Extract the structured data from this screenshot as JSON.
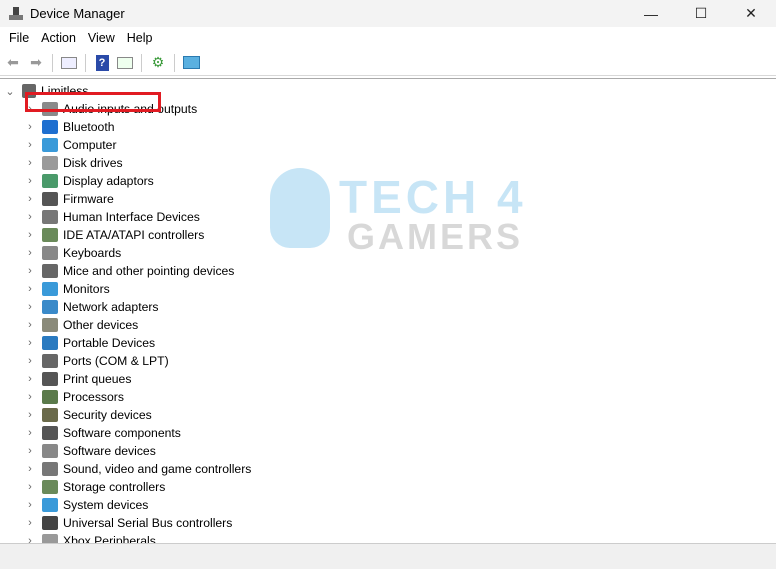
{
  "window": {
    "title": "Device Manager",
    "minimize": "—",
    "maximize": "☐",
    "close": "✕"
  },
  "menu": [
    "File",
    "Action",
    "View",
    "Help"
  ],
  "toolbar": {
    "icons": [
      "back-arrow-icon",
      "forward-arrow-icon",
      "properties-icon",
      "help-icon",
      "update-driver-icon",
      "scan-hardware-icon",
      "monitor-icon"
    ]
  },
  "tree": {
    "root": "Limitless",
    "items": [
      {
        "label": "Audio inputs and outputs",
        "color": "#8a8a8a"
      },
      {
        "label": "Bluetooth",
        "color": "#1e6fd0"
      },
      {
        "label": "Computer",
        "color": "#3a9ad9"
      },
      {
        "label": "Disk drives",
        "color": "#9a9a9a"
      },
      {
        "label": "Display adaptors",
        "color": "#4a9a6a"
      },
      {
        "label": "Firmware",
        "color": "#555555"
      },
      {
        "label": "Human Interface Devices",
        "color": "#777777"
      },
      {
        "label": "IDE ATA/ATAPI controllers",
        "color": "#6a8a5a"
      },
      {
        "label": "Keyboards",
        "color": "#888888"
      },
      {
        "label": "Mice and other pointing devices",
        "color": "#666666"
      },
      {
        "label": "Monitors",
        "color": "#3a9ad9"
      },
      {
        "label": "Network adapters",
        "color": "#3a8ac9"
      },
      {
        "label": "Other devices",
        "color": "#8a8a7a"
      },
      {
        "label": "Portable Devices",
        "color": "#2a7ac0"
      },
      {
        "label": "Ports (COM & LPT)",
        "color": "#666666"
      },
      {
        "label": "Print queues",
        "color": "#555555"
      },
      {
        "label": "Processors",
        "color": "#5a7a4a"
      },
      {
        "label": "Security devices",
        "color": "#6a6a4a"
      },
      {
        "label": "Software components",
        "color": "#555555"
      },
      {
        "label": "Software devices",
        "color": "#888888"
      },
      {
        "label": "Sound, video and game controllers",
        "color": "#777777"
      },
      {
        "label": "Storage controllers",
        "color": "#6a8a5a"
      },
      {
        "label": "System devices",
        "color": "#3a9ad9"
      },
      {
        "label": "Universal Serial Bus controllers",
        "color": "#444444"
      },
      {
        "label": "Xbox Peripherals",
        "color": "#999999"
      }
    ],
    "highlighted": "Display adaptors",
    "highlight_color": "#e11b22"
  },
  "watermark": {
    "line1": "TECH 4",
    "line2": "GAMERS"
  }
}
